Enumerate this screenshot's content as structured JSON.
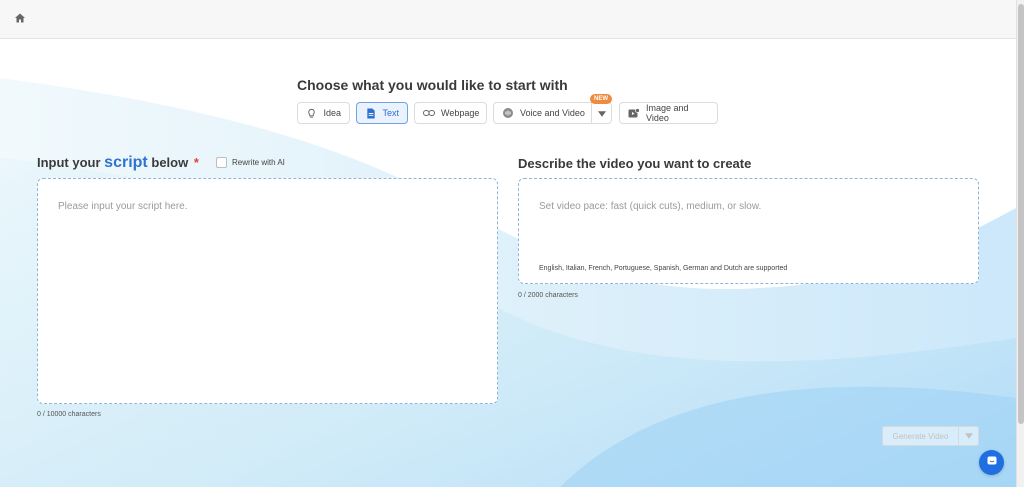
{
  "header": {
    "home_icon": "home-icon"
  },
  "chooser": {
    "title": "Choose what you would like to start with",
    "modes": [
      {
        "label": "Idea",
        "icon": "lightbulb-icon"
      },
      {
        "label": "Text",
        "icon": "document-icon",
        "active": true
      },
      {
        "label": "Webpage",
        "icon": "link-icon"
      },
      {
        "label": "Voice and Video",
        "icon": "voice-icon",
        "badge": "NEW"
      },
      {
        "label": "Image and Video",
        "icon": "image-video-icon"
      }
    ]
  },
  "script_panel": {
    "title_prefix": "Input your",
    "title_highlight": "script",
    "title_suffix": "below",
    "required_mark": "*",
    "rewrite_label": "Rewrite with AI",
    "placeholder": "Please input your script here.",
    "char_count": "0 / 10000 characters"
  },
  "describe_panel": {
    "title": "Describe the video you want to create",
    "placeholder": "Set video pace: fast (quick cuts), medium, or slow.",
    "languages_note": "English, Italian, French, Portuguese, Spanish, German and Dutch are supported",
    "char_count": "0 / 2000 characters"
  },
  "actions": {
    "generate_label": "Generate Video"
  },
  "colors": {
    "accent": "#2f74d0",
    "badge": "#f08a3c",
    "chat": "#1f6fe0"
  }
}
